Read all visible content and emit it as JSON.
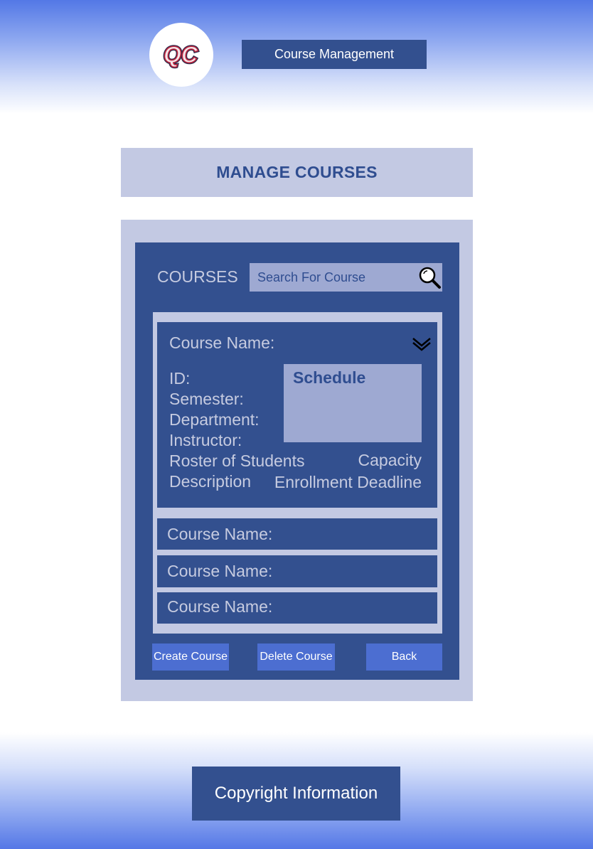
{
  "header": {
    "logo_text": "QC",
    "title": "Course Management"
  },
  "page": {
    "title": "MANAGE COURSES"
  },
  "courses_panel": {
    "heading": "COURSES",
    "search": {
      "placeholder": "Search For Course",
      "value": "",
      "icon": "search-icon"
    },
    "expanded_course": {
      "name_label": "Course Name:",
      "toggle_icon": "chevron-down-icon",
      "fields": {
        "id": "ID:",
        "semester": "Semester:",
        "department": "Department:",
        "instructor": "Instructor:",
        "roster": "Roster of Students",
        "description": "Description",
        "capacity": "Capacity",
        "deadline": "Enrollment Deadline"
      },
      "schedule_label": "Schedule"
    },
    "collapsed_courses": [
      {
        "name_label": "Course Name:"
      },
      {
        "name_label": "Course Name:"
      },
      {
        "name_label": "Course Name:"
      }
    ],
    "buttons": {
      "create": "Create Course",
      "delete": "Delete Course",
      "back": "Back"
    }
  },
  "footer": {
    "text": "Copyright Information"
  },
  "colors": {
    "primary": "#33508f",
    "panel": "#c3c9e3",
    "accent_button": "#4c6ed1",
    "muted_text": "#c6cbe0",
    "search_bg": "#9ea9d2",
    "logo_red": "#c2263f"
  }
}
